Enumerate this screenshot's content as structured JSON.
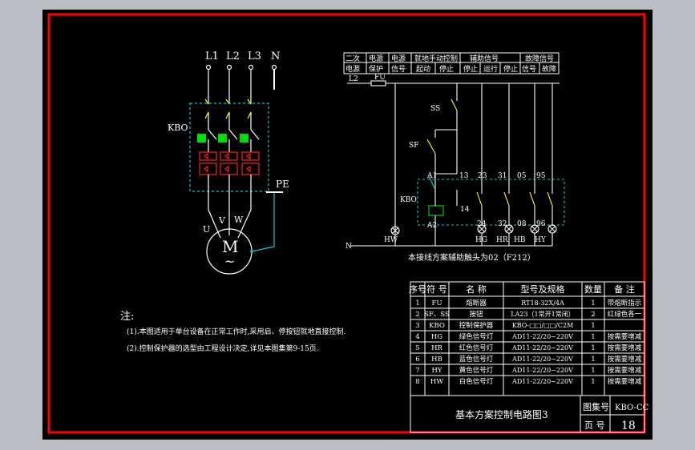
{
  "colors": {
    "frame": "#ff0000",
    "wire": "#ffffff",
    "cyan": "#00d2d2",
    "green": "#00e000",
    "yellow": "#ffff00",
    "red": "#ff2020"
  },
  "power": {
    "phases": [
      "L1",
      "L2",
      "L3",
      "N"
    ],
    "breaker": "KBO",
    "motor_terminals": [
      "U",
      "V",
      "W"
    ],
    "motor": "M",
    "motor_sub": "~",
    "pe": "PE"
  },
  "control": {
    "header_row1": [
      "二次",
      "电源",
      "电源",
      "就地手动控制",
      "",
      "辅助信号",
      "",
      "故障信号"
    ],
    "header_row2": [
      "电源",
      "保护",
      "信号",
      "起动",
      "停止",
      "停止",
      "运行",
      "停止",
      "信号",
      "故障"
    ],
    "l2": "L2",
    "n": "N",
    "fu": "FU",
    "ss": "SS",
    "sf": "SF",
    "kbo": "KBO",
    "contacts": [
      "A1",
      "13",
      "23",
      "31",
      "05",
      "95"
    ],
    "coil_bottom": [
      "A2",
      "14"
    ],
    "lamp_nums": [
      "24",
      "32",
      "08",
      "96"
    ],
    "lamps": [
      "HW",
      "HG",
      "HR",
      "HB",
      "HY"
    ],
    "note": "本接线方案辅助触头为02（F212）"
  },
  "notes": {
    "title": "注:",
    "line1": "(1).本图适用于单台设备在正常工作时,采用启、停按钮就地直接控制.",
    "line2": "(2).控制保护器的选型由工程设计决定,详见本图集第9-15页."
  },
  "parts_table": {
    "headers": [
      "序号",
      "符 号",
      "名 称",
      "型号及规格",
      "数量",
      "备 注"
    ],
    "rows": [
      [
        "1",
        "FU",
        "熔断器",
        "RT18-32X/4A",
        "1",
        "带熔断指示"
      ],
      [
        "2",
        "SF、SS",
        "按钮",
        "LA23（1常开1常闭）",
        "2",
        "红绿色各一"
      ],
      [
        "3",
        "KBO",
        "控制保护器",
        "KBO-□□/□□/C2M",
        "1",
        ""
      ],
      [
        "4",
        "HG",
        "绿色信号灯",
        "AD11-22/20~220V",
        "1",
        "按需要增减"
      ],
      [
        "5",
        "HR",
        "红色信号灯",
        "AD11-22/20~220V",
        "1",
        "按需要增减"
      ],
      [
        "6",
        "HB",
        "蓝色信号灯",
        "AD11-22/20~220V",
        "1",
        "按需要增减"
      ],
      [
        "7",
        "HY",
        "黄色信号灯",
        "AD11-22/20~220V",
        "1",
        "按需要增减"
      ],
      [
        "8",
        "HW",
        "白色信号灯",
        "AD11-22/20~220V",
        "1",
        "按需要增减"
      ]
    ]
  },
  "title_block": {
    "title": "基本方案控制电路图3",
    "atlas_label": "图集号",
    "atlas_value": "KBO-CC",
    "page_label": "页 号",
    "page_value": "18"
  }
}
